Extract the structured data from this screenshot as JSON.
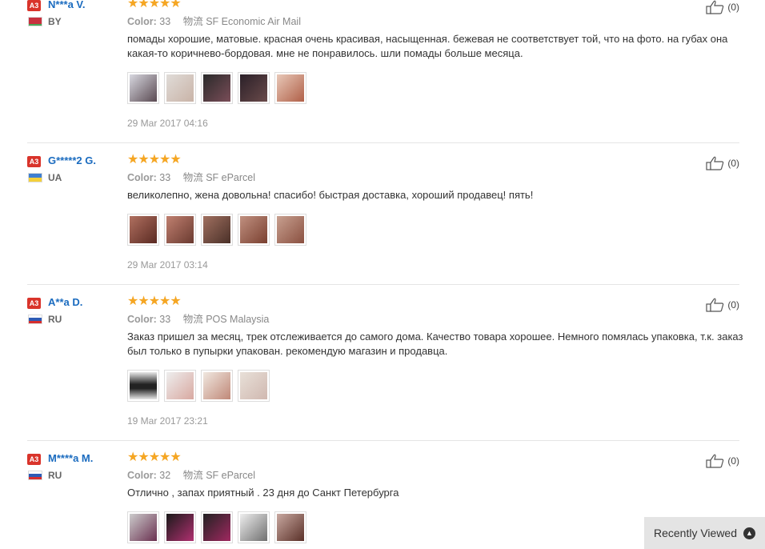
{
  "reviews": [
    {
      "badge": "A3",
      "name": "N***a V.",
      "country": "BY",
      "flag_colors": [
        "#c8313e",
        "#4aa657"
      ],
      "stars": "★★★★★",
      "color_label": "Color:",
      "color_value": "33",
      "shipping_label": "物流",
      "shipping": "SF Economic Air Mail",
      "text": "помады хорошие, матовые. красная очень красивая, насыщенная. бежевая не соответствует той, что на фото. на губах она какая-то коричнево-бордовая. мне не понравилось. шли помады больше месяца.",
      "thumb_colors": [
        "#5a4a52",
        "#c9b3a7",
        "#7a4d58",
        "#3a3038",
        "#b06048"
      ],
      "date": "29 Mar 2017 04:16",
      "likes": "(0)"
    },
    {
      "badge": "A3",
      "name": "G*****2 G.",
      "country": "UA",
      "flag_colors": [
        "#3f7fd1",
        "#f4d03a"
      ],
      "stars": "★★★★★",
      "color_label": "Color:",
      "color_value": "33",
      "shipping_label": "物流",
      "shipping": "SF eParcel",
      "text": "великолепно, жена довольна! спасибо! быстрая доставка, хороший продавец! пять!",
      "thumb_colors": [
        "#8b4a3a",
        "#9a5a48",
        "#7a5040",
        "#9b5a4c",
        "#a86a58"
      ],
      "date": "29 Mar 2017 03:14",
      "likes": "(0)"
    },
    {
      "badge": "A3",
      "name": "A**a D.",
      "country": "RU",
      "flag_colors": [
        "#ffffff",
        "#2d5bb5",
        "#d62e2e"
      ],
      "stars": "★★★★★",
      "color_label": "Color:",
      "color_value": "33",
      "shipping_label": "物流",
      "shipping": "POS Malaysia",
      "text": "Заказ пришел за месяц, трек отслеживается до самого дома. Качество товара хорошее. Немного помялась упаковка, т.к. заказ был только в пупырки упакован. рекомендую магазин и продавца.",
      "thumb_colors": [
        "#444444",
        "#d8a8a0",
        "#c08878",
        "#d0b8b0"
      ],
      "date": "19 Mar 2017 23:21",
      "likes": "(0)"
    },
    {
      "badge": "A3",
      "name": "M****a M.",
      "country": "RU",
      "flag_colors": [
        "#ffffff",
        "#2d5bb5",
        "#d62e2e"
      ],
      "stars": "★★★★★",
      "color_label": "Color:",
      "color_value": "32",
      "shipping_label": "物流",
      "shipping": "SF eParcel",
      "text": "Отлично , запах приятный . 23 дня до Санкт Петербурга",
      "thumb_colors": [
        "#6a3050",
        "#4a2838",
        "#5a3040",
        "#707070",
        "#9a7068"
      ],
      "date": "",
      "likes": "(0)"
    }
  ],
  "recently_viewed": {
    "label": "Recently Viewed",
    "icon": "chevron-up-icon"
  }
}
